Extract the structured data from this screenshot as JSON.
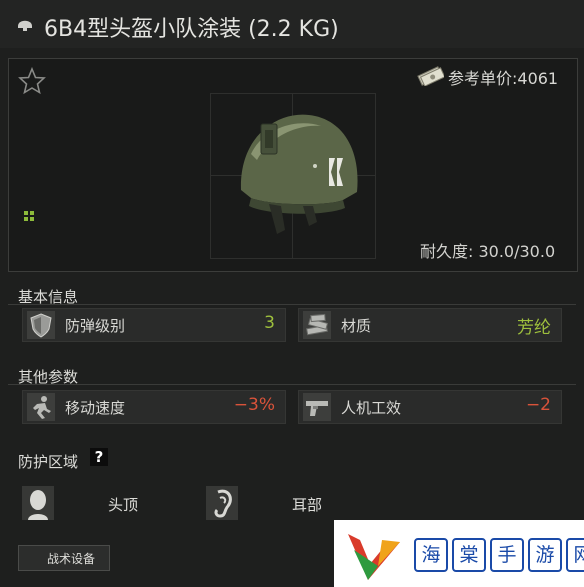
{
  "window": {
    "title": "6B4型头盔小队涂装 (2.2 KG)"
  },
  "item": {
    "reference_price_label": "参考单价:4061",
    "durability_label": "耐久度: 30.0/30.0"
  },
  "basic_info": {
    "heading": "基本信息",
    "stats": [
      {
        "icon": "shield-icon",
        "label": "防弹级别",
        "value": "3",
        "color": "#9ec03d"
      },
      {
        "icon": "material-icon",
        "label": "材质",
        "value": "芳纶",
        "color": "#9ec03d"
      }
    ]
  },
  "other_params": {
    "heading": "其他参数",
    "stats": [
      {
        "icon": "running-icon",
        "label": "移动速度",
        "value": "−3%",
        "color": "#d9533a"
      },
      {
        "icon": "pistol-icon",
        "label": "人机工效",
        "value": "−2",
        "color": "#d9533a"
      }
    ]
  },
  "protection": {
    "heading": "防护区域",
    "help": "?",
    "zones": [
      {
        "icon": "head-top-icon",
        "label": "头顶"
      },
      {
        "icon": "ear-icon",
        "label": "耳部"
      }
    ]
  },
  "tactical_button": {
    "label": "战术设备"
  },
  "watermark": {
    "chars": [
      "海",
      "棠",
      "手",
      "游",
      "网"
    ]
  }
}
